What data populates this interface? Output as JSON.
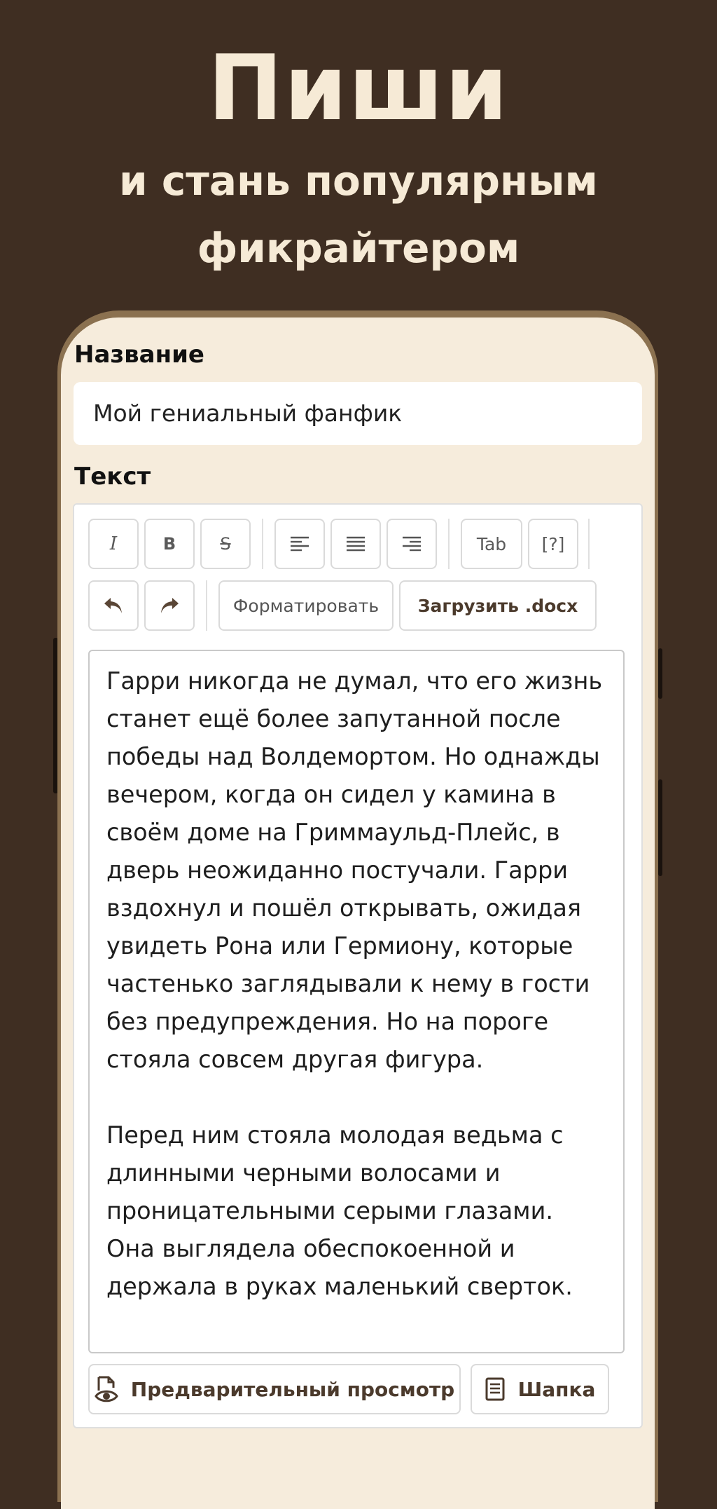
{
  "hero": {
    "title": "Пиши",
    "subtitle_line1": "и стань популярным",
    "subtitle_line2": "фикрайтером"
  },
  "form": {
    "title_label": "Название",
    "title_value": "Мой гениальный фанфик",
    "text_label": "Текст"
  },
  "toolbar": {
    "italic": "I",
    "bold": "B",
    "strike": "S",
    "tab": "Tab",
    "help": "[?]",
    "format": "Форматировать",
    "upload": "Загрузить .docx"
  },
  "editor": {
    "content": "Гарри никогда не думал, что его жизнь станет ещё более запутанной после победы над Волдемортом. Но однажды вечером, когда он сидел у камина в своём доме на Гриммаульд-Плейс, в дверь неожиданно постучали. Гарри вздохнул и пошёл открывать, ожидая увидеть Рона или Гермиону, которые частенько заглядывали к нему в гости без предупреждения. Но на пороге стояла совсем другая фигура.\n\nПеред ним стояла молодая ведьма с длинными черными волосами и проницательными серыми глазами. Она выглядела обеспокоенной и держала в руках маленький сверток."
  },
  "actions": {
    "preview": "Предварительный просмотр",
    "header": "Шапка"
  },
  "colors": {
    "background": "#3f2e22",
    "hero_text": "#f6ead6",
    "phone_frame": "#8b7150",
    "screen": "#f6ecdc",
    "accent_text": "#4b3a2c"
  }
}
